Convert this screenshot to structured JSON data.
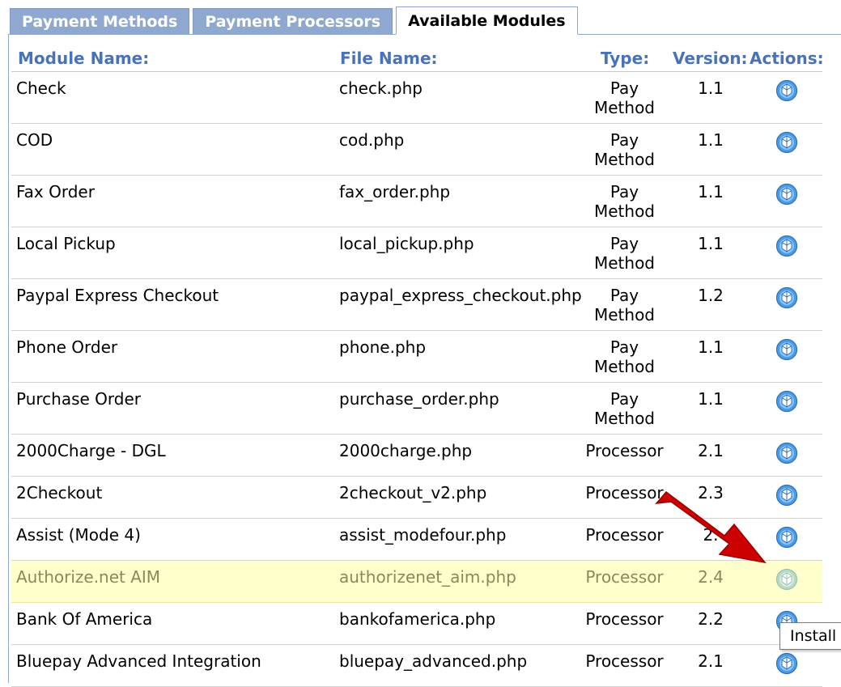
{
  "tabs": [
    {
      "label": "Payment Methods"
    },
    {
      "label": "Payment Processors"
    },
    {
      "label": "Available Modules"
    }
  ],
  "table": {
    "headers": {
      "module_name": "Module Name:",
      "file_name": "File Name:",
      "type": "Type:",
      "version": "Version:",
      "actions": "Actions:"
    },
    "rows": [
      {
        "name": "Check",
        "file": "check.php",
        "type_line1": "Pay",
        "type_line2": "Method",
        "version": "1.1",
        "action_icon": "install-icon"
      },
      {
        "name": "COD",
        "file": "cod.php",
        "type_line1": "Pay",
        "type_line2": "Method",
        "version": "1.1",
        "action_icon": "install-icon"
      },
      {
        "name": "Fax Order",
        "file": "fax_order.php",
        "type_line1": "Pay",
        "type_line2": "Method",
        "version": "1.1",
        "action_icon": "install-icon"
      },
      {
        "name": "Local Pickup",
        "file": "local_pickup.php",
        "type_line1": "Pay",
        "type_line2": "Method",
        "version": "1.1",
        "action_icon": "install-icon"
      },
      {
        "name": "Paypal Express Checkout",
        "file": "paypal_express_checkout.php",
        "type_line1": "Pay",
        "type_line2": "Method",
        "version": "1.2",
        "action_icon": "install-icon"
      },
      {
        "name": "Phone Order",
        "file": "phone.php",
        "type_line1": "Pay",
        "type_line2": "Method",
        "version": "1.1",
        "action_icon": "install-icon"
      },
      {
        "name": "Purchase Order",
        "file": "purchase_order.php",
        "type_line1": "Pay",
        "type_line2": "Method",
        "version": "1.1",
        "action_icon": "install-icon"
      },
      {
        "name": "2000Charge - DGL",
        "file": "2000charge.php",
        "type_line1": "Processor",
        "type_line2": "",
        "version": "2.1",
        "action_icon": "install-icon"
      },
      {
        "name": "2Checkout",
        "file": "2checkout_v2.php",
        "type_line1": "Processor",
        "type_line2": "",
        "version": "2.3",
        "action_icon": "install-icon"
      },
      {
        "name": "Assist (Mode 4)",
        "file": "assist_modefour.php",
        "type_line1": "Processor",
        "type_line2": "",
        "version": "2.",
        "action_icon": "install-icon"
      },
      {
        "name": "Authorize.net AIM",
        "file": "authorizenet_aim.php",
        "type_line1": "Processor",
        "type_line2": "",
        "version": "2.4",
        "action_icon": "install-icon",
        "highlighted": true
      },
      {
        "name": "Bank Of America",
        "file": "bankofamerica.php",
        "type_line1": "Processor",
        "type_line2": "",
        "version": "2.2",
        "action_icon": "install-icon"
      },
      {
        "name": "Bluepay Advanced Integration",
        "file": "bluepay_advanced.php",
        "type_line1": "Processor",
        "type_line2": "",
        "version": "2.1",
        "action_icon": "install-icon"
      }
    ]
  },
  "tooltip": {
    "text": "Install"
  },
  "colors": {
    "tab_inactive": "#8fa8d0",
    "header_text": "#4a72b7",
    "highlight_row": "#ffffcc",
    "arrow": "#cc0000",
    "icon_blue": "#3a8fe0"
  }
}
